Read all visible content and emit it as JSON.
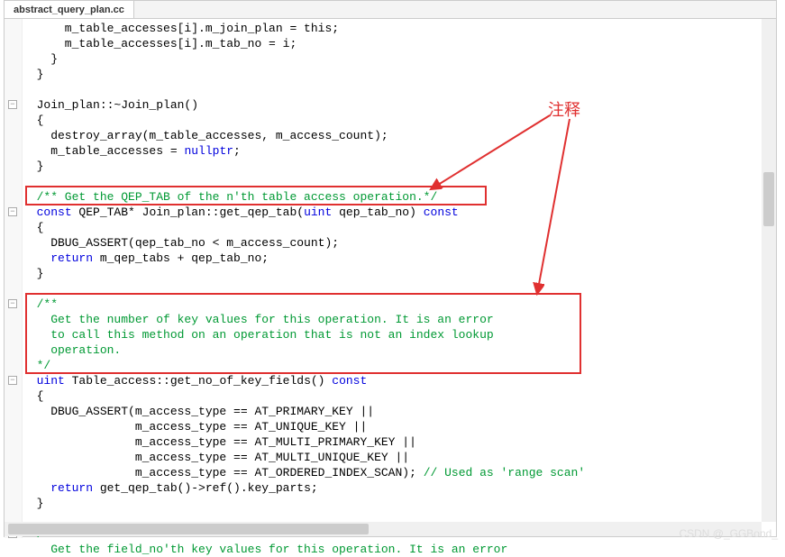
{
  "tab": {
    "title": "abstract_query_plan.cc"
  },
  "annotation": {
    "label": "注释"
  },
  "code": {
    "lines": [
      {
        "indent": 3,
        "class": "",
        "text": "m_table_accesses[i].m_join_plan = this;"
      },
      {
        "indent": 3,
        "class": "",
        "text": "m_table_accesses[i].m_tab_no = i;"
      },
      {
        "indent": 2,
        "class": "",
        "text": "}"
      },
      {
        "indent": 1,
        "class": "",
        "text": "}"
      },
      {
        "indent": 1,
        "class": "",
        "text": ""
      },
      {
        "indent": 1,
        "class": "",
        "text": "Join_plan::~Join_plan()"
      },
      {
        "indent": 1,
        "class": "",
        "text": "{"
      },
      {
        "indent": 2,
        "class": "",
        "text": "destroy_array(m_table_accesses, m_access_count);"
      },
      {
        "indent": 2,
        "class": "",
        "html": "m_table_accesses = <span class=\"kw\">nullptr</span>;"
      },
      {
        "indent": 1,
        "class": "",
        "text": "}"
      },
      {
        "indent": 1,
        "class": "",
        "text": ""
      },
      {
        "indent": 1,
        "class": "cm",
        "text": "/** Get the QEP_TAB of the n'th table access operation.*/"
      },
      {
        "indent": 1,
        "class": "",
        "html": "<span class=\"kw\">const</span> QEP_TAB* Join_plan::get_qep_tab(<span class=\"kw\">uint</span> qep_tab_no) <span class=\"kw\">const</span>"
      },
      {
        "indent": 1,
        "class": "",
        "text": "{"
      },
      {
        "indent": 2,
        "class": "",
        "text": "DBUG_ASSERT(qep_tab_no < m_access_count);"
      },
      {
        "indent": 2,
        "class": "",
        "html": "<span class=\"kw\">return</span> m_qep_tabs + qep_tab_no;"
      },
      {
        "indent": 1,
        "class": "",
        "text": "}"
      },
      {
        "indent": 1,
        "class": "",
        "text": ""
      },
      {
        "indent": 1,
        "class": "cm",
        "text": "/**"
      },
      {
        "indent": 2,
        "class": "cm",
        "text": "Get the number of key values for this operation. It is an error"
      },
      {
        "indent": 2,
        "class": "cm",
        "text": "to call this method on an operation that is not an index lookup"
      },
      {
        "indent": 2,
        "class": "cm",
        "text": "operation."
      },
      {
        "indent": 1,
        "class": "cm",
        "text": "*/"
      },
      {
        "indent": 1,
        "class": "",
        "html": "<span class=\"kw\">uint</span> Table_access::get_no_of_key_fields() <span class=\"kw\">const</span>"
      },
      {
        "indent": 1,
        "class": "",
        "text": "{"
      },
      {
        "indent": 2,
        "class": "",
        "text": "DBUG_ASSERT(m_access_type == AT_PRIMARY_KEY ||"
      },
      {
        "indent": 8,
        "class": "",
        "text": "m_access_type == AT_UNIQUE_KEY ||"
      },
      {
        "indent": 8,
        "class": "",
        "text": "m_access_type == AT_MULTI_PRIMARY_KEY ||"
      },
      {
        "indent": 8,
        "class": "",
        "text": "m_access_type == AT_MULTI_UNIQUE_KEY ||"
      },
      {
        "indent": 8,
        "class": "",
        "html": "m_access_type == AT_ORDERED_INDEX_SCAN); <span class=\"cm\">// Used as 'range scan'</span>"
      },
      {
        "indent": 2,
        "class": "",
        "html": "<span class=\"kw\">return</span> get_qep_tab()->ref().key_parts;"
      },
      {
        "indent": 1,
        "class": "",
        "text": "}"
      },
      {
        "indent": 1,
        "class": "",
        "text": ""
      },
      {
        "indent": 1,
        "class": "cm",
        "text": "/**"
      },
      {
        "indent": 2,
        "class": "cm",
        "text": "Get the field_no'th key values for this operation. It is an error"
      }
    ],
    "fold_markers": [
      {
        "line": 5,
        "sym": "−"
      },
      {
        "line": 12,
        "sym": "−"
      },
      {
        "line": 18,
        "sym": "−"
      },
      {
        "line": 23,
        "sym": "−"
      },
      {
        "line": 33,
        "sym": "−"
      }
    ]
  },
  "watermark": "CSDN @_GGBond_"
}
